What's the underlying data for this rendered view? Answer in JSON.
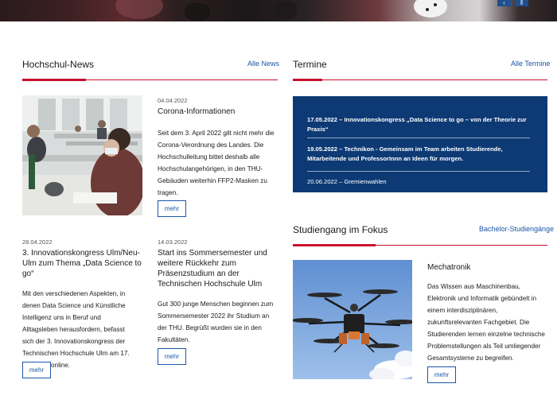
{
  "hero": {
    "nav_prev": "‹",
    "nav_pause": "‖"
  },
  "news": {
    "title": "Hochschul-News",
    "link": "Alle News",
    "articles": [
      {
        "date": "04.04.2022",
        "title": "Corona-Informationen",
        "body": "Seit dem 3. April 2022 gilt nicht mehr die Corona-Verordnung des Landes. Die Hochschulleitung bittet deshalb alle Hochschulangehörigen, in den THU-Gebäuden weiterhin FFP2-Masken zu tragen.",
        "more": "mehr"
      },
      {
        "date": "28.04.2022",
        "title": "3. Innovationskongress Ulm/Neu-Ulm zum Thema „Data Science to go“",
        "body": "Mit den verschiedenen Aspekten, in denen Data Science und Künstliche Intelligenz uns in Beruf und Alltagsleben herausfordern, befasst sich der 3. Innovationskongress der Technischen Hochschule Ulm am 17. Mai 2022 online.",
        "more": "mehr"
      },
      {
        "date": "14.03.2022",
        "title": "Start ins Sommersemester und weitere Rückkehr zum Präsenzstudium an der Technischen Hochschule Ulm",
        "body": "Gut 300 junge Menschen beginnen zum Sommersemester 2022 ihr Studium an der THU. Begrüßt wurden sie in den Fakultäten.",
        "more": "mehr"
      }
    ]
  },
  "termine": {
    "title": "Termine",
    "link": "Alle Termine",
    "items": [
      "17.05.2022 – Innovationskongress „Data Science to go – von der Theorie zur Praxis“",
      "19.05.2022 – Technikon - Gemeinsam im Team arbeiten Studierende, Mitarbeitende und ProfessorInnn an Ideen für morgen.",
      "20.06.2022 – Gremienwahlen"
    ]
  },
  "fokus": {
    "title": "Studiengang im Fokus",
    "link": "Bachelor-Studiengänge",
    "program_title": "Mechatronik",
    "body": "Das Wissen aus Maschinenbau, Elektronik und Informatik gebündelt in einem interdisziplinären, zukunftsrelevanten Fachgebiet. Die Studierenden lernen einzelne technische Problemstellungen als Teil umliegender Gesamtsysteme zu begreifen.",
    "more": "mehr"
  },
  "colors": {
    "accent": "#c8102e",
    "link": "#1a56a6",
    "termine_bg": "#0d3a74"
  }
}
